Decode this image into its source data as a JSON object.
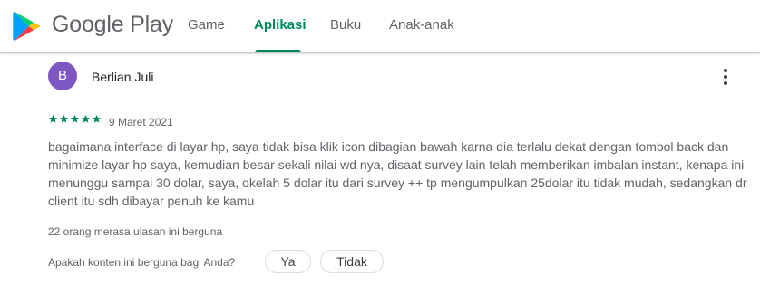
{
  "header": {
    "brand": "Google Play",
    "tabs": [
      {
        "label": "Game",
        "active": false
      },
      {
        "label": "Aplikasi",
        "active": true
      },
      {
        "label": "Buku",
        "active": false
      },
      {
        "label": "Anak-anak",
        "active": false
      }
    ],
    "logo_icon": "google-play-logo",
    "accent_color": "#01875f"
  },
  "review": {
    "avatar_letter": "B",
    "avatar_color": "#7e57c2",
    "author": "Berlian Juli",
    "rating": 5,
    "star_color": "#01875f",
    "date": "9 Maret 2021",
    "text": "bagaimana interface di layar hp, saya tidak bisa klik icon dibagian bawah karna dia terlalu dekat dengan tombol back dan minimize layar hp saya, kemudian besar sekali nilai wd nya, disaat survey lain telah memberikan imbalan instant, kenapa ini menunggu sampai 30 dolar, saya, okelah 5 dolar itu dari survey ++ tp mengumpulkan 25dolar itu tidak mudah, sedangkan dr client itu sdh dibayar penuh ke kamu",
    "helpful_count": "22 orang merasa ulasan ini berguna",
    "feedback_question": "Apakah konten ini berguna bagi Anda?",
    "yes_label": "Ya",
    "no_label": "Tidak",
    "more_icon": "more-vert-icon"
  }
}
